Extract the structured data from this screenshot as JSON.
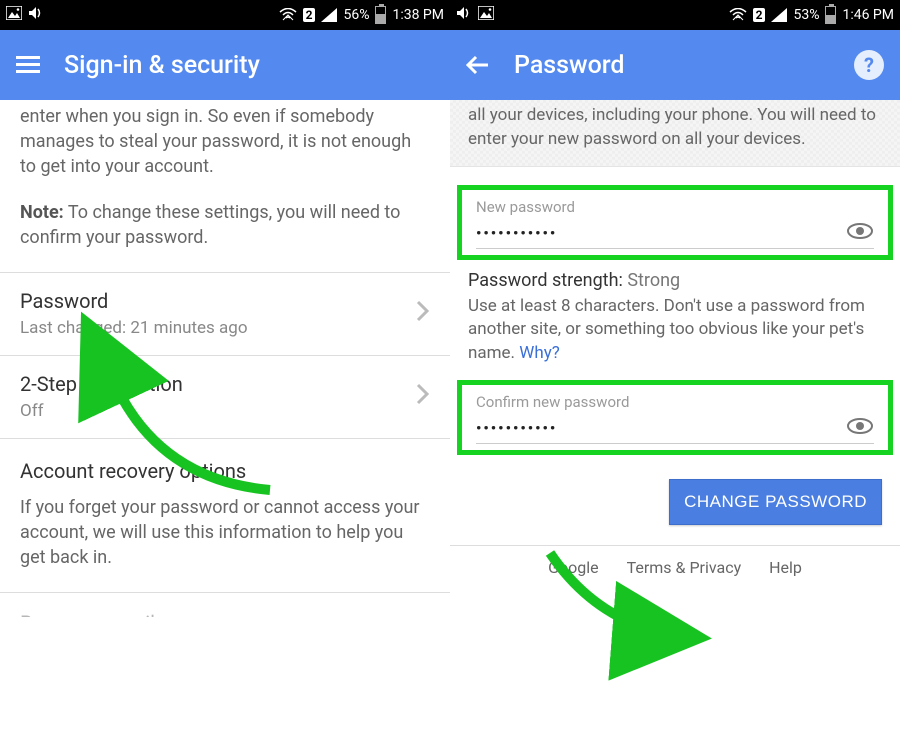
{
  "left": {
    "status": {
      "battery_pct": "56%",
      "time": "1:38 PM",
      "battery_fill": 56
    },
    "appbar": {
      "title": "Sign-in & security"
    },
    "intro_tail": "enter when you sign in. So even if somebody manages to steal your password, it is not enough to get into your account.",
    "note_label": "Note:",
    "note_text": " To change these settings, you will need to confirm your password.",
    "rows": {
      "password": {
        "label": "Password",
        "sub": "Last changed: 21 minutes ago"
      },
      "twostep": {
        "label": "2-Step Verification",
        "sub": "Off"
      }
    },
    "recovery": {
      "title": "Account recovery options",
      "text": "If you forget your password or cannot access your account, we will use this information to help you get back in."
    },
    "cutoff": "Recovery email"
  },
  "right": {
    "status": {
      "battery_pct": "53%",
      "time": "1:46 PM",
      "battery_fill": 53
    },
    "appbar": {
      "title": "Password"
    },
    "banner_tail": "all your devices, including your phone. You will need to enter your new password on all your devices.",
    "fields": {
      "new": {
        "label": "New password",
        "value": "•••••••••••"
      },
      "confirm": {
        "label": "Confirm new password",
        "value": "•••••••••••"
      }
    },
    "strength": {
      "label": "Password strength: ",
      "value": "Strong"
    },
    "hint": {
      "text": "Use at least 8 characters. Don't use a password from another site, or something too obvious like your pet's name. ",
      "link": "Why?"
    },
    "button": "CHANGE PASSWORD",
    "footer": {
      "a": "Google",
      "b": "Terms & Privacy",
      "c": "Help"
    }
  }
}
